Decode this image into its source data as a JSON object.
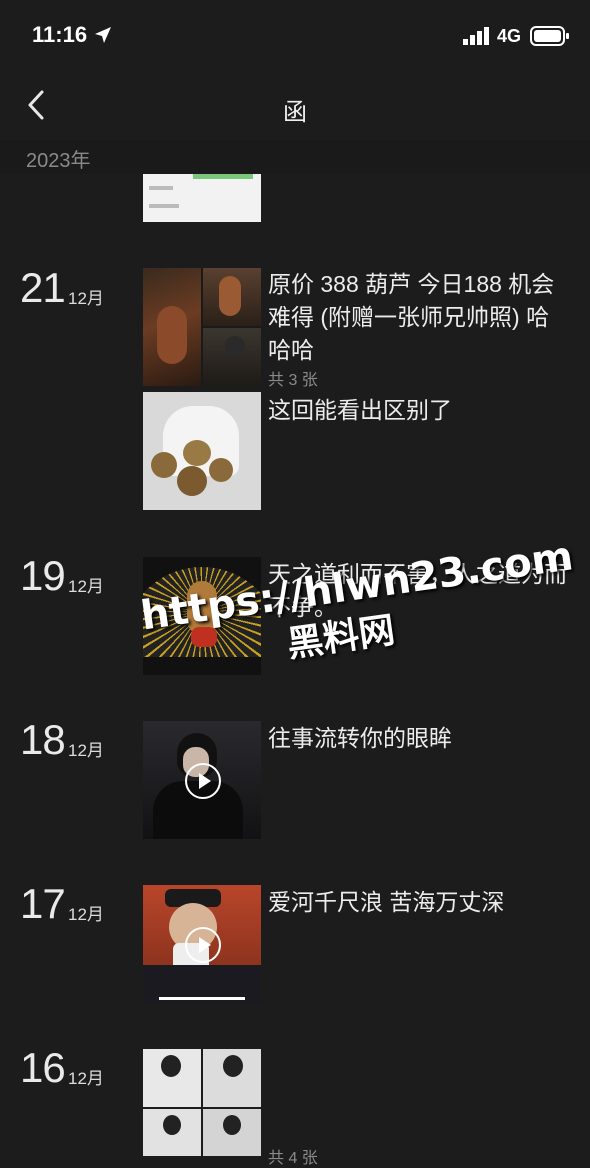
{
  "status_bar": {
    "time": "11:16",
    "network": "4G",
    "icons": [
      "location-arrow-icon",
      "signal-bars-icon",
      "battery-icon"
    ]
  },
  "nav": {
    "title": "函",
    "back_icon": "chevron-left-icon"
  },
  "year_header": "2023年",
  "posts": [
    {
      "day": "21",
      "month": "12月",
      "text": "原价 388 葫芦  今日188 机会难得 (附赠一张师兄帅照) 哈哈哈",
      "count": "共 3 张"
    },
    {
      "text": "这回能看出区别了"
    },
    {
      "day": "19",
      "month": "12月",
      "text": "天之道利而不害，人之道为而不争。"
    },
    {
      "day": "18",
      "month": "12月",
      "text": "往事流转你的眼眸"
    },
    {
      "day": "17",
      "month": "12月",
      "text": "爱河千尺浪 苦海万丈深"
    },
    {
      "day": "16",
      "month": "12月",
      "count": "共 4 张"
    }
  ],
  "watermark": {
    "url": "https://hlwn23.com",
    "name": "黑料网"
  },
  "colors": {
    "background": "#1c1c1c",
    "text": "#ececec",
    "muted": "#8a8a8a"
  }
}
